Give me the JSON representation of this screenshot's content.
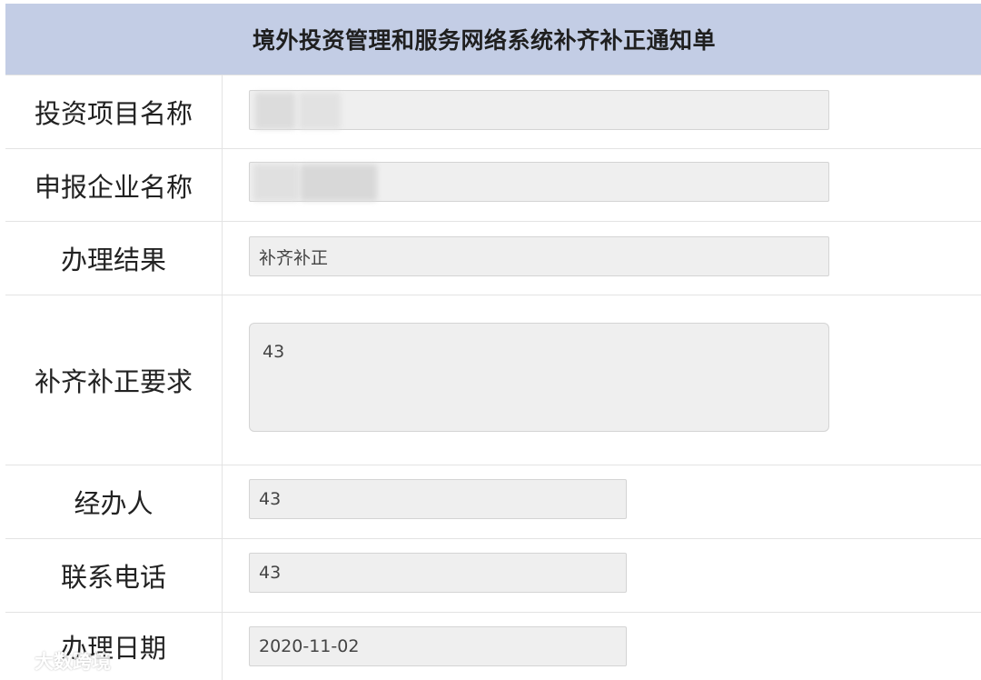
{
  "header": {
    "title": "境外投资管理和服务网络系统补齐补正通知单"
  },
  "rows": [
    {
      "label": "投资项目名称",
      "value": ""
    },
    {
      "label": "申报企业名称",
      "value": ""
    },
    {
      "label": "办理结果",
      "value": "补齐补正"
    },
    {
      "label": "补齐补正要求",
      "value": "43"
    },
    {
      "label": "经办人",
      "value": "43"
    },
    {
      "label": "联系电话",
      "value": "43"
    },
    {
      "label": "办理日期",
      "value": "2020-11-02"
    }
  ],
  "watermark": {
    "text": "大数跨境",
    "icon": "logo-icon"
  },
  "colors": {
    "header_bg": "#c3cde5",
    "field_bg": "#efefef",
    "border": "#e3e3e3"
  }
}
